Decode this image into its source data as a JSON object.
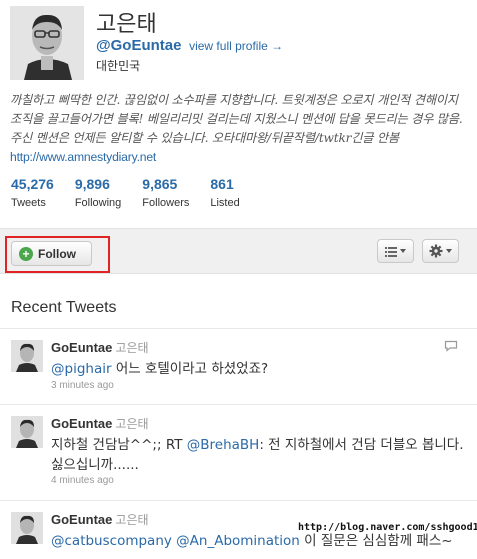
{
  "profile": {
    "name": "고은태",
    "handle": "@GoEuntae",
    "view_full_profile": "view full profile →",
    "location": "대한민국"
  },
  "bio": {
    "text": "까칠하고 삐딱한 인간. 끊임없이 소수파를 지향합니다. 트윗계정은 오로지 개인적 견해이지 조직을 끌고들어가면 블록! 베일리리밋 걸리는데 지웠스니 멘션에 답을 못드리는 경우 많음. 주신 멘션은 언제든 알티할 수 있습니다. 오타대마왕/뒤끝작렬/twtkr긴글 안봄",
    "link": "http://www.amnestydiary.net"
  },
  "stats": [
    {
      "value": "45,276",
      "label": "Tweets"
    },
    {
      "value": "9,896",
      "label": "Following"
    },
    {
      "value": "9,865",
      "label": "Followers"
    },
    {
      "value": "861",
      "label": "Listed"
    }
  ],
  "actions": {
    "follow_label": "Follow"
  },
  "recent_heading": "Recent Tweets",
  "tweets": [
    {
      "user": "GoEuntae",
      "user_kr": "고은태",
      "mention": "@pighair",
      "text": " 어느 호텔이라고 하셨었죠?",
      "time": "3 minutes ago"
    },
    {
      "user": "GoEuntae",
      "user_kr": "고은태",
      "text_a": "지하철 건담남^^;; RT ",
      "mention": "@BrehaBH",
      "text_b": ": 전 지하철에서 건담 더블오 봅니다. 싫으십니까......",
      "time": "4 minutes ago"
    },
    {
      "user": "GoEuntae",
      "user_kr": "고은태",
      "mention_a": "@catbuscompany",
      "mention_b": "@An_Abomination",
      "text": " 이 질문은 심심함께 패스~"
    }
  ],
  "watermark": "http://blog.naver.com/sshgood1"
}
